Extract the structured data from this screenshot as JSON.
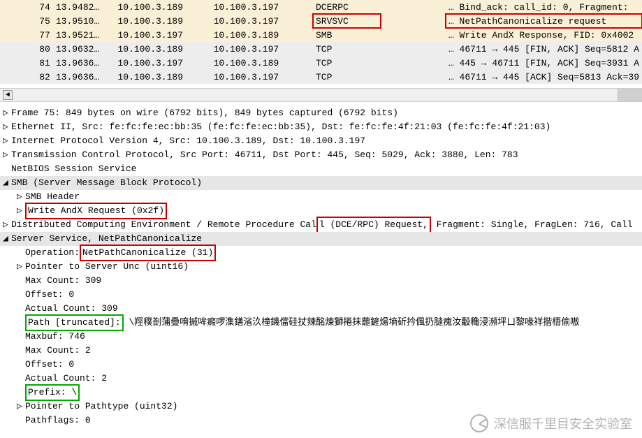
{
  "packets": [
    {
      "no": "74",
      "time": "13.9482…",
      "src": "10.100.3.189",
      "dst": "10.100.3.197",
      "proto": "DCERPC",
      "info": "… Bind_ack: call_id: 0, Fragment:",
      "cls": "row-cream",
      "hi": false
    },
    {
      "no": "75",
      "time": "13.9510…",
      "src": "10.100.3.189",
      "dst": "10.100.3.197",
      "proto": "SRVSVC",
      "info": "… NetPathCanonicalize request",
      "cls": "row-cream",
      "hi": true
    },
    {
      "no": "77",
      "time": "13.9521…",
      "src": "10.100.3.197",
      "dst": "10.100.3.189",
      "proto": "SMB",
      "info": "… Write AndX Response, FID: 0x4002",
      "cls": "row-cream",
      "hi": false
    },
    {
      "no": "80",
      "time": "13.9632…",
      "src": "10.100.3.189",
      "dst": "10.100.3.197",
      "proto": "TCP",
      "info": "… 46711 → 445 [FIN, ACK] Seq=5812 A",
      "cls": "row-gray",
      "hi": false
    },
    {
      "no": "81",
      "time": "13.9636…",
      "src": "10.100.3.197",
      "dst": "10.100.3.189",
      "proto": "TCP",
      "info": "… 445 → 46711 [FIN, ACK] Seq=3931 A",
      "cls": "row-gray",
      "hi": false
    },
    {
      "no": "82",
      "time": "13.9636…",
      "src": "10.100.3.189",
      "dst": "10.100.3.197",
      "proto": "TCP",
      "info": "… 46711 → 445 [ACK] Seq=5813 Ack=39",
      "cls": "row-gray",
      "hi": false
    }
  ],
  "detail": {
    "frame": "Frame 75: 849 bytes on wire (6792 bits), 849 bytes captured (6792 bits)",
    "eth": "Ethernet II, Src: fe:fc:fe:ec:bb:35 (fe:fc:fe:ec:bb:35), Dst: fe:fc:fe:4f:21:03 (fe:fc:fe:4f:21:03)",
    "ip": "Internet Protocol Version 4, Src: 10.100.3.189, Dst: 10.100.3.197",
    "tcp": "Transmission Control Protocol, Src Port: 46711, Dst Port: 445, Seq: 5029, Ack: 3880, Len: 783",
    "nb": "NetBIOS Session Service",
    "smb": "SMB (Server Message Block Protocol)",
    "smbhdr": "SMB Header",
    "write_pre": "Write AndX Request (0x2f)",
    "dce_pre": "Distributed Computing Environment / Remote Procedure Cal",
    "dce_mid": "l (DCE/RPC) Request,",
    "dce_post": " Fragment: Single, FragLen: 716, Call",
    "srv": "Server Service, NetPathCanonicalize",
    "op_pre": "Operation:",
    "op_val": " NetPathCanonicalize (31)",
    "ptrunc": "Pointer to Server Unc (uint16)",
    "maxcount": "Max Count: 309",
    "offset": "Offset: 0",
    "actual": "Actual Count: 309",
    "path_lbl": "Path [truncated]:",
    "path_val": " \\羥穙剳蒲疊唷摵哞癜啰潗鐥渻汣橦鐖儅硅扙辣酩煉獅捲抹藣鏟煬墒斫扲偑扔膖瘣汝觳穐浸瀕坪ㄩ黎喙祥揩梧偷嗷",
    "maxbuf": "Maxbuf: 746",
    "maxcount2": "Max Count: 2",
    "offset2": "Offset: 0",
    "actual2": "Actual Count: 2",
    "prefix": "Prefix: \\",
    "ptrpath": "Pointer to Pathtype (uint32)",
    "pathflags": "Pathflags: 0"
  },
  "watermark": "深信服千里目安全实验室"
}
